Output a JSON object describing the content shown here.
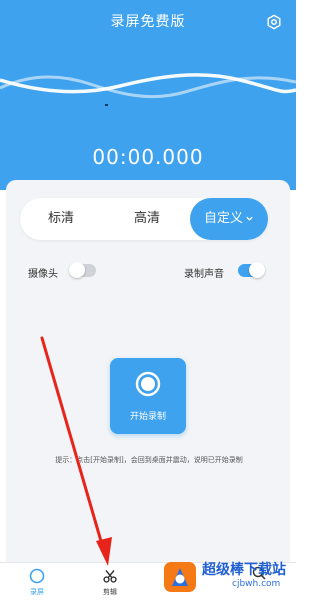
{
  "app": {
    "title": "录屏免费版",
    "timer": "00:00.000"
  },
  "quality": {
    "options": [
      "标清",
      "高清",
      "自定义"
    ],
    "selected": "自定义"
  },
  "settings": {
    "camera_label": "摄像头",
    "camera_on": false,
    "audio_label": "录制声音",
    "audio_on": true
  },
  "record_button": {
    "label": "开始录制"
  },
  "hint": "提示：点击[开始录制]，会回到桌面并震动，说明已开始录制",
  "nav": {
    "items": [
      {
        "label": "录屏",
        "active": true
      },
      {
        "label": "剪辑",
        "active": false
      }
    ]
  },
  "watermark": {
    "logo_text": "超级",
    "text": "超级棒下载站",
    "url": "cjbwh.com"
  },
  "colors": {
    "primary": "#3fa2ee",
    "annotation_arrow": "#e8231a"
  }
}
